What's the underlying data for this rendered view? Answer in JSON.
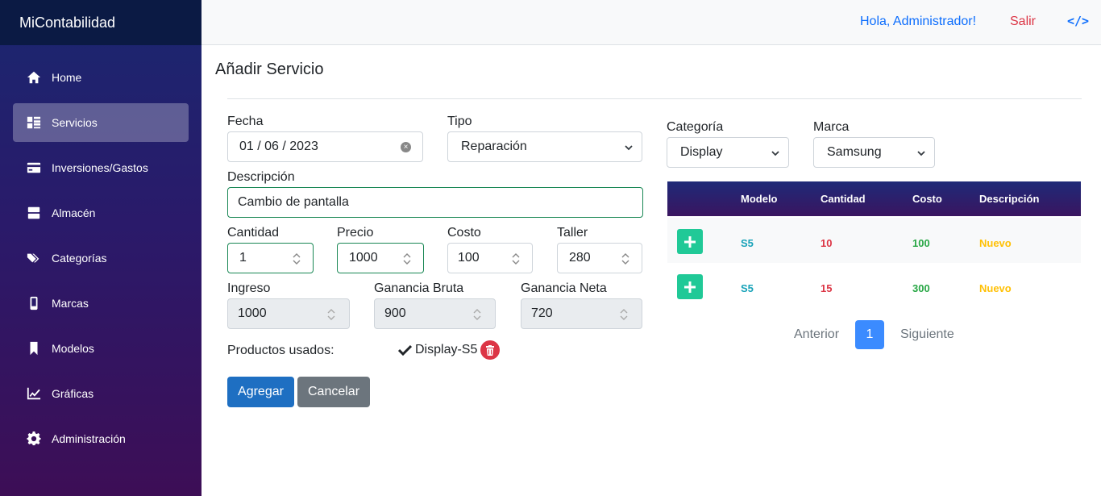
{
  "app": {
    "brand": "MiContabilidad"
  },
  "sidebar": {
    "items": [
      {
        "label": "Home",
        "icon": "home-icon"
      },
      {
        "label": "Servicios",
        "icon": "list-icon",
        "active": true
      },
      {
        "label": "Inversiones/Gastos",
        "icon": "card-icon"
      },
      {
        "label": "Almacén",
        "icon": "box-icon"
      },
      {
        "label": "Categorías",
        "icon": "tags-icon"
      },
      {
        "label": "Marcas",
        "icon": "mobile-icon"
      },
      {
        "label": "Modelos",
        "icon": "bookmark-icon"
      },
      {
        "label": "Gráficas",
        "icon": "chart-line-icon"
      },
      {
        "label": "Administración",
        "icon": "gear-icon"
      }
    ]
  },
  "header": {
    "greeting": "Hola, Administrador!",
    "logout": "Salir",
    "code_icon": "</>"
  },
  "page": {
    "title": "Añadir Servicio"
  },
  "form": {
    "fecha_label": "Fecha",
    "fecha_value": "01 / 06 / 2023",
    "tipo_label": "Tipo",
    "tipo_value": "Reparación",
    "descripcion_label": "Descripción",
    "descripcion_value": "Cambio de pantalla",
    "cantidad_label": "Cantidad",
    "cantidad_value": "1",
    "precio_label": "Precio",
    "precio_value": "1000",
    "costo_label": "Costo",
    "costo_value": "100",
    "taller_label": "Taller",
    "taller_value": "280",
    "ingreso_label": "Ingreso",
    "ingreso_value": "1000",
    "ganancia_bruta_label": "Ganancia Bruta",
    "ganancia_bruta_value": "900",
    "ganancia_neta_label": "Ganancia Neta",
    "ganancia_neta_value": "720",
    "productos_label": "Productos usados:",
    "producto_usado": "Display-S5",
    "agregar": "Agregar",
    "cancelar": "Cancelar"
  },
  "filters": {
    "categoria_label": "Categoría",
    "categoria_value": "Display",
    "marca_label": "Marca",
    "marca_value": "Samsung"
  },
  "table": {
    "headers": [
      "",
      "Modelo",
      "Cantidad",
      "Costo",
      "Descripción"
    ],
    "rows": [
      {
        "modelo": "S5",
        "cantidad": "10",
        "costo": "100",
        "descripcion": "Nuevo"
      },
      {
        "modelo": "S5",
        "cantidad": "15",
        "costo": "300",
        "descripcion": "Nuevo"
      }
    ],
    "colors": {
      "modelo": "#17a2b8",
      "cantidad": "#dc3545",
      "costo": "#28a745",
      "descripcion": "#ffc107"
    }
  },
  "pagination": {
    "prev": "Anterior",
    "current": "1",
    "next": "Siguiente"
  }
}
